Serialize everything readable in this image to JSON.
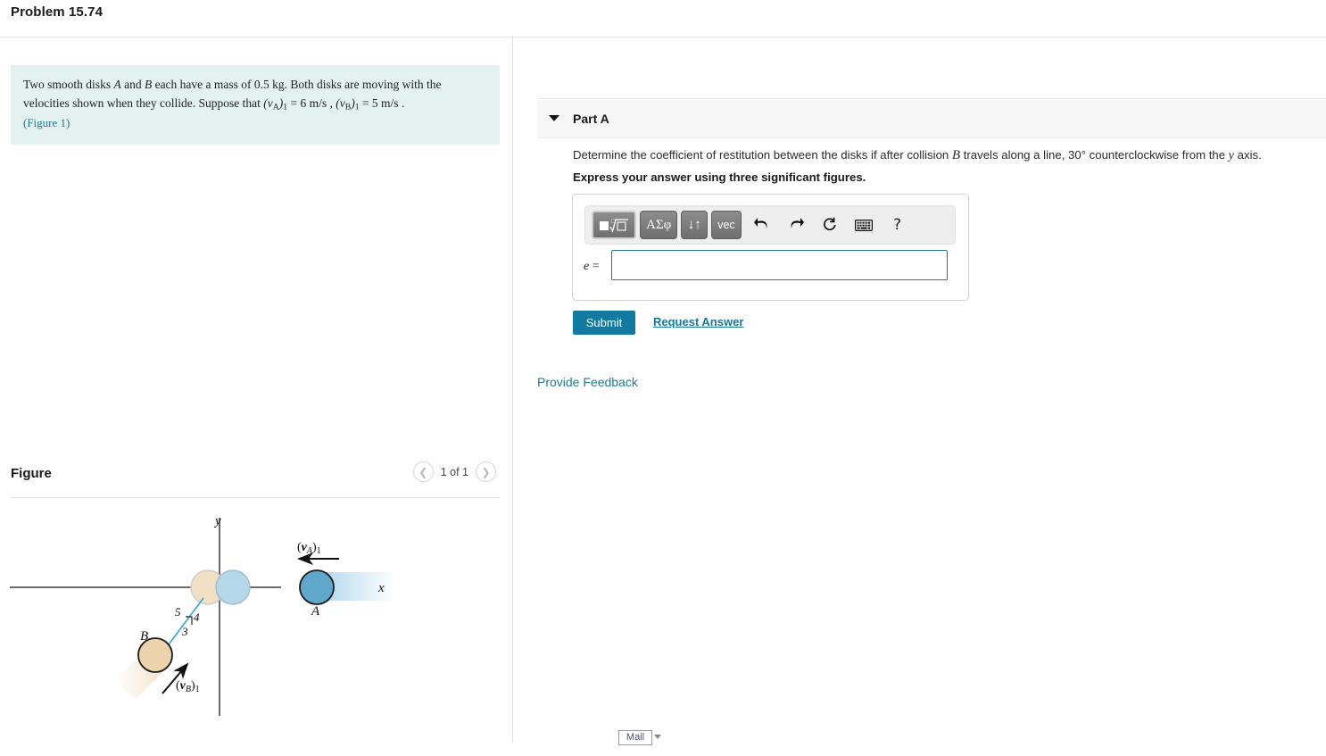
{
  "header": {
    "title": "Problem 15.74"
  },
  "problem": {
    "line1_a": "Two smooth disks ",
    "A": "A",
    "line1_b": " and ",
    "B": "B",
    "line1_c": " each have a mass of ",
    "mass": "0.5 kg",
    "line1_d": ". Both disks are moving with the velocities shown when they collide. Suppose that ",
    "vA_expr": "(v",
    "vA_sub": "A",
    "vA_close": ")",
    "vA_idx": "1",
    "vA_val": " = 6  m/s",
    "comma": " , ",
    "vB_expr": "(v",
    "vB_sub": "B",
    "vB_close": ")",
    "vB_idx": "1",
    "vB_val": " = 5  m/s",
    "period": " .",
    "figure_link": "(Figure 1)"
  },
  "figure": {
    "title": "Figure",
    "counter": "1 of 1",
    "prev_icon": "chevron-left-icon",
    "next_icon": "chevron-right-icon",
    "labels": {
      "x_axis": "x",
      "y_axis": "y",
      "disk_A": "A",
      "disk_B": "B",
      "vA": "(v",
      "vA_sub": "A",
      "vA_idx": "1",
      "vB": "(v",
      "vB_sub": "B",
      "vB_idx": "1",
      "tri_hyp": "5",
      "tri_vert": "4",
      "tri_horiz": "3"
    },
    "colors": {
      "disk_A_fill": "#5fa8cc",
      "disk_B_fill": "#edd3ab",
      "ghost_blue": "#b4d7ea",
      "ghost_tan": "#f2e0c5",
      "slope_line": "#29a8e0",
      "axis": "#6b6b6b"
    }
  },
  "part_a": {
    "label": "Part A",
    "caret_icon": "caret-down-icon",
    "question_a": "Determine the coefficient of restitution between the disks if after collision ",
    "question_B": "B",
    "question_b": " travels along a line, 30° counterclockwise from the ",
    "question_y": "y",
    "question_c": " axis.",
    "instruction": "Express your answer using three significant figures.",
    "toolbar": {
      "template_btn": "▣√▯",
      "greek_btn": "ΑΣφ",
      "updown_btn": "↓↑",
      "vec_btn": "vec",
      "undo_icon": "undo-arrow-icon",
      "redo_icon": "redo-arrow-icon",
      "reset_icon": "refresh-circle-icon",
      "keyboard_icon": "keyboard-icon",
      "help_icon": "question-mark-icon",
      "undo_glyph": "↰",
      "redo_glyph": "↱",
      "reset_glyph": "↻",
      "keyboard_glyph": "⌨",
      "help_glyph": "?"
    },
    "answer_label": "e =",
    "answer_value": "",
    "answer_placeholder": "",
    "submit_label": "Submit",
    "request_answer_label": "Request Answer"
  },
  "footer": {
    "feedback_label": "Provide Feedback",
    "mail_label": "Mail"
  }
}
